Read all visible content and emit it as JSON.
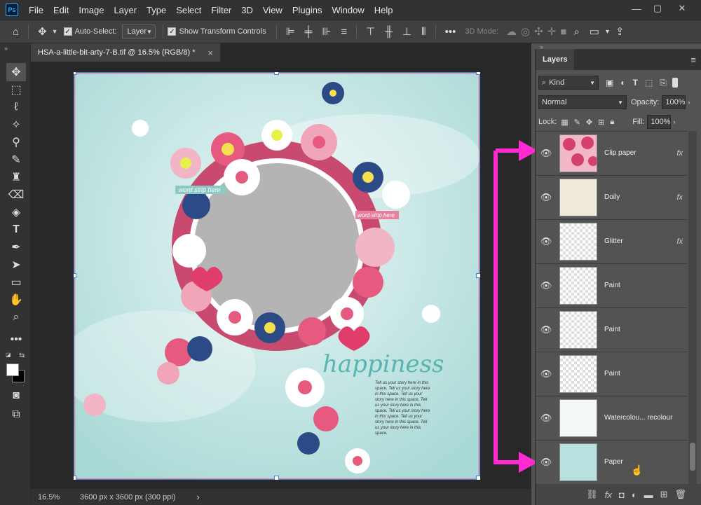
{
  "app": {
    "logo": "Ps"
  },
  "menubar": {
    "items": [
      "File",
      "Edit",
      "Image",
      "Layer",
      "Type",
      "Select",
      "Filter",
      "3D",
      "View",
      "Plugins",
      "Window",
      "Help"
    ]
  },
  "options": {
    "auto_select_label": "Auto-Select:",
    "auto_select_value": "Layer",
    "show_transform_label": "Show Transform Controls",
    "mode_3d_label": "3D Mode:"
  },
  "document": {
    "tab_title": "HSA-a-little-bit-arty-7-B.tif @ 16.5% (RGB/8) *",
    "close": "×",
    "title_text": "happiness",
    "strip_text_1": "word strip here",
    "strip_text_2": "word strip here",
    "journal_text": "Tell us your story here in this space. Tell us your story here in this space. Tell us your story here in this space. Tell us your story here in this space. Tell us your story here in this space. Tell us your story here in this space. Tell us your story here in this space."
  },
  "status": {
    "zoom": "16.5%",
    "dims": "3600 px x 3600 px (300 ppi)",
    "arrow": "›"
  },
  "layers_panel": {
    "tab": "Layers",
    "filter_kind": "Kind",
    "blend_mode": "Normal",
    "opacity_label": "Opacity:",
    "opacity_value": "100%",
    "lock_label": "Lock:",
    "fill_label": "Fill:",
    "fill_value": "100%",
    "layers": [
      {
        "name": "Clip paper",
        "fx": "fx"
      },
      {
        "name": "Doily",
        "fx": "fx"
      },
      {
        "name": "Glitter",
        "fx": "fx"
      },
      {
        "name": "Paint",
        "fx": ""
      },
      {
        "name": "Paint",
        "fx": ""
      },
      {
        "name": "Paint",
        "fx": ""
      },
      {
        "name": "Watercolou... recolour",
        "fx": ""
      },
      {
        "name": "Paper",
        "fx": ""
      }
    ]
  },
  "colors": {
    "arrow": "#ff2bd1",
    "paper": "#b7e0de",
    "clip": "#d6406d"
  }
}
